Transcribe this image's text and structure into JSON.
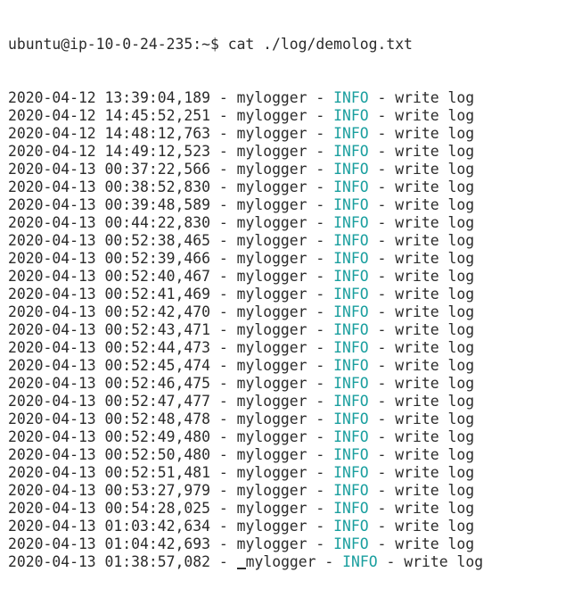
{
  "terminal": {
    "prompt": "ubuntu@ip-10-0-24-235:~$ cat ./log/demolog.txt",
    "level_color": "#1a9f9f",
    "log_lines": [
      {
        "timestamp": "2020-04-12 13:39:04,189",
        "logger": "mylogger",
        "level": "INFO",
        "message": "write log"
      },
      {
        "timestamp": "2020-04-12 14:45:52,251",
        "logger": "mylogger",
        "level": "INFO",
        "message": "write log"
      },
      {
        "timestamp": "2020-04-12 14:48:12,763",
        "logger": "mylogger",
        "level": "INFO",
        "message": "write log"
      },
      {
        "timestamp": "2020-04-12 14:49:12,523",
        "logger": "mylogger",
        "level": "INFO",
        "message": "write log"
      },
      {
        "timestamp": "2020-04-13 00:37:22,566",
        "logger": "mylogger",
        "level": "INFO",
        "message": "write log"
      },
      {
        "timestamp": "2020-04-13 00:38:52,830",
        "logger": "mylogger",
        "level": "INFO",
        "message": "write log"
      },
      {
        "timestamp": "2020-04-13 00:39:48,589",
        "logger": "mylogger",
        "level": "INFO",
        "message": "write log"
      },
      {
        "timestamp": "2020-04-13 00:44:22,830",
        "logger": "mylogger",
        "level": "INFO",
        "message": "write log"
      },
      {
        "timestamp": "2020-04-13 00:52:38,465",
        "logger": "mylogger",
        "level": "INFO",
        "message": "write log"
      },
      {
        "timestamp": "2020-04-13 00:52:39,466",
        "logger": "mylogger",
        "level": "INFO",
        "message": "write log"
      },
      {
        "timestamp": "2020-04-13 00:52:40,467",
        "logger": "mylogger",
        "level": "INFO",
        "message": "write log"
      },
      {
        "timestamp": "2020-04-13 00:52:41,469",
        "logger": "mylogger",
        "level": "INFO",
        "message": "write log"
      },
      {
        "timestamp": "2020-04-13 00:52:42,470",
        "logger": "mylogger",
        "level": "INFO",
        "message": "write log"
      },
      {
        "timestamp": "2020-04-13 00:52:43,471",
        "logger": "mylogger",
        "level": "INFO",
        "message": "write log"
      },
      {
        "timestamp": "2020-04-13 00:52:44,473",
        "logger": "mylogger",
        "level": "INFO",
        "message": "write log"
      },
      {
        "timestamp": "2020-04-13 00:52:45,474",
        "logger": "mylogger",
        "level": "INFO",
        "message": "write log"
      },
      {
        "timestamp": "2020-04-13 00:52:46,475",
        "logger": "mylogger",
        "level": "INFO",
        "message": "write log"
      },
      {
        "timestamp": "2020-04-13 00:52:47,477",
        "logger": "mylogger",
        "level": "INFO",
        "message": "write log"
      },
      {
        "timestamp": "2020-04-13 00:52:48,478",
        "logger": "mylogger",
        "level": "INFO",
        "message": "write log"
      },
      {
        "timestamp": "2020-04-13 00:52:49,480",
        "logger": "mylogger",
        "level": "INFO",
        "message": "write log"
      },
      {
        "timestamp": "2020-04-13 00:52:50,480",
        "logger": "mylogger",
        "level": "INFO",
        "message": "write log"
      },
      {
        "timestamp": "2020-04-13 00:52:51,481",
        "logger": "mylogger",
        "level": "INFO",
        "message": "write log"
      },
      {
        "timestamp": "2020-04-13 00:53:27,979",
        "logger": "mylogger",
        "level": "INFO",
        "message": "write log"
      },
      {
        "timestamp": "2020-04-13 00:54:28,025",
        "logger": "mylogger",
        "level": "INFO",
        "message": "write log"
      },
      {
        "timestamp": "2020-04-13 01:03:42,634",
        "logger": "mylogger",
        "level": "INFO",
        "message": "write log"
      },
      {
        "timestamp": "2020-04-13 01:04:42,693",
        "logger": "mylogger",
        "level": "INFO",
        "message": "write log"
      },
      {
        "timestamp": "2020-04-13 01:38:57,082",
        "logger": "mylogger",
        "level": "INFO",
        "message": "write log",
        "cursor": true
      }
    ]
  }
}
